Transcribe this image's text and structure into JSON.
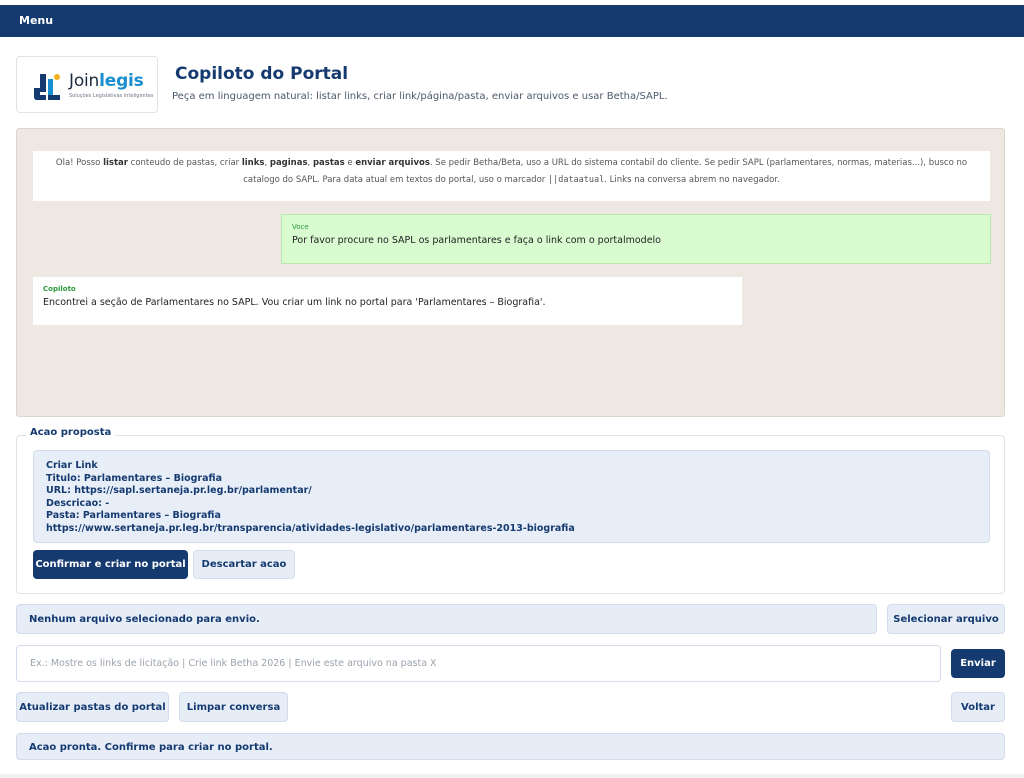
{
  "menu": {
    "label": "Menu"
  },
  "logo": {
    "word_main": "Join",
    "word_accent": "legis",
    "tagline": "Soluções Legislativas Inteligentes",
    "mark_colors": [
      "#153a70",
      "#1a8fd0",
      "#f2b01e"
    ]
  },
  "header": {
    "title": "Copiloto do Portal",
    "subtitle": "Peça em linguagem natural: listar links, criar link/página/pasta, enviar arquivos e usar Betha/SAPL."
  },
  "chat": {
    "welcome": {
      "p1": "Ola! Posso ",
      "b1": "listar",
      "p2": " conteudo de pastas, criar ",
      "b2": "links",
      "p3": ", ",
      "b3": "paginas",
      "p4": ", ",
      "b4": "pastas",
      "p5": " e ",
      "b5": "enviar arquivos",
      "p6": ". Se pedir Betha/Beta, uso a URL do sistema contabil do cliente. Se pedir SAPL (parlamentares, normas, materias...), busco no catalogo do SAPL. Para data atual em textos do portal, uso o marcador ",
      "code": "||dataatual",
      "p7": ". Links na conversa abrem no navegador."
    },
    "user": {
      "who": "Voce",
      "text": "Por favor procure no SAPL os parlamentares e faça o link com o portalmodelo"
    },
    "bot": {
      "who": "Copiloto",
      "text": "Encontrei a seção de Parlamentares no SAPL. Vou criar um link no portal para 'Parlamentares – Biografia'."
    }
  },
  "action": {
    "legend": "Acao proposta",
    "lines": [
      "Criar Link",
      "Titulo: Parlamentares – Biografia",
      "URL: https://sapl.sertaneja.pr.leg.br/parlamentar/",
      "Descricao: -",
      "Pasta: Parlamentares – Biografia",
      "https://www.sertaneja.pr.leg.br/transparencia/atividades-legislativo/parlamentares-2013-biografia"
    ],
    "confirm": "Confirmar e criar no portal",
    "discard": "Descartar acao"
  },
  "file": {
    "status": "Nenhum arquivo selecionado para envio.",
    "select": "Selecionar arquivo"
  },
  "input": {
    "placeholder": "Ex.: Mostre os links de licitação | Crie link Betha 2026 | Envie este arquivo na pasta X",
    "send": "Enviar"
  },
  "footer": {
    "refresh": "Atualizar pastas do portal",
    "clear": "Limpar conversa",
    "back": "Voltar",
    "status": "Acao pronta. Confirme para criar no portal."
  }
}
